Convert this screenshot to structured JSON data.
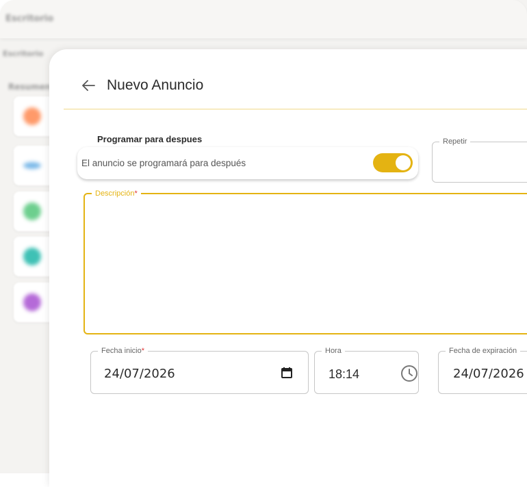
{
  "background": {
    "app_title": "Escritorio",
    "breadcrumb": "Escritorio",
    "section": "Resumen",
    "card_colors": [
      "#ff9a6a",
      "#7ab8e8",
      "#6dcf8e",
      "#3fc1b5",
      "#b56ad8"
    ]
  },
  "header": {
    "title": "Nuevo Anuncio"
  },
  "schedule": {
    "label": "Programar para despues",
    "text": "El anuncio se programará para después",
    "enabled": true,
    "accent": "#e4b312"
  },
  "repeat": {
    "label": "Repetir",
    "value": ""
  },
  "description": {
    "label": "Descripción",
    "required_mark": "*",
    "value": ""
  },
  "start_date": {
    "label": "Fecha inicio",
    "required_mark": "*",
    "value": "24/07/2026"
  },
  "time": {
    "label": "Hora",
    "value": "18:14"
  },
  "expiration": {
    "label": "Fecha de expiración",
    "value": "24/07/2026"
  }
}
